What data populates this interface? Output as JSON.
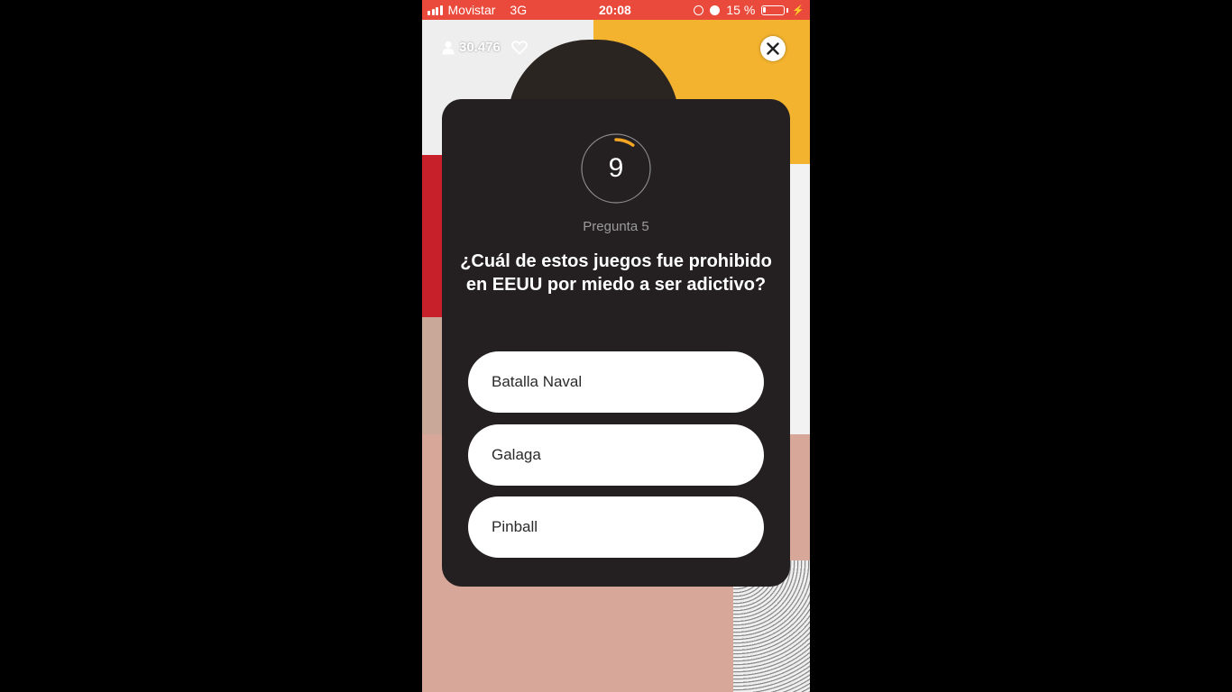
{
  "status_bar": {
    "carrier": "Movistar",
    "network": "3G",
    "time": "20:08",
    "battery_text": "15 %",
    "battery_level": 0.15,
    "bar_color": "#ea4a3b"
  },
  "stream": {
    "viewer_count": "30.476",
    "icons": [
      "person-icon",
      "heart-icon",
      "close-icon"
    ]
  },
  "quiz": {
    "timer": "9",
    "timer_progress": 0.1,
    "timer_color": "#f5a623",
    "question_label": "Pregunta 5",
    "question": "¿Cuál de estos juegos fue prohibido en EEUU por miedo a ser adictivo?",
    "answers": [
      "Batalla Naval",
      "Galaga",
      "Pinball"
    ]
  }
}
